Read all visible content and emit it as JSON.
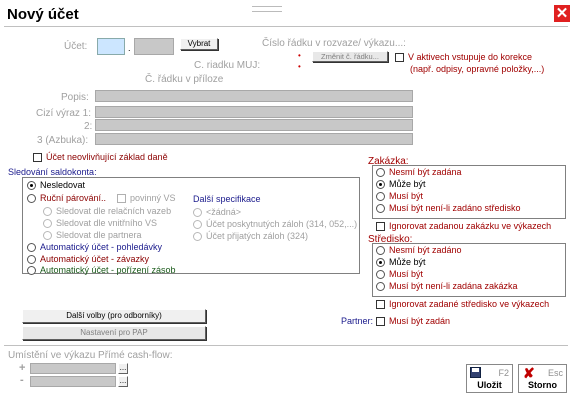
{
  "title": "Nový účet",
  "form": {
    "ucet_label": "Účet:",
    "ucet_sep": ".",
    "vybrat_label": "Vybrat",
    "cislo_radku_label": "Číslo řádku v rozvaze/ výkazu...:",
    "cislo_radku_dot": "•",
    "zmenit_label": "Změnit č. řádku...",
    "riadku_muj_label": "C. riadku MUJ:",
    "riadku_muj_dot": "•",
    "radku_priloze_label": "Č. řádku v příloze",
    "aktivech_label": "V aktivech vstupuje do korekce",
    "aktivech_sub": "(např. odpisy, opravné položky,...)",
    "popis_label": "Popis:",
    "cizi1_label": "Cizí výraz 1:",
    "cizi2_label": "2:",
    "cizi3_label": "3 (Azbuka):",
    "neovlivnujici_label": "Účet neovlivňující základ daně"
  },
  "saldo": {
    "title": "Sledování saldokonta:",
    "nesledovat": "Nesledovat",
    "rucni": "Ruční párování..",
    "povinny_vs": "povinný VS",
    "rel_vazeb": "Sledovat dle relačních vazeb",
    "vnitrniho_vs": "Sledovat dle vnitřního VS",
    "partnera": "Sledovat dle partnera",
    "dalsi_spec": "Další specifikace",
    "zadna": "<žádná>",
    "poskytnutych": "Účet poskytnutých záloh (314, 052,...)",
    "prijatych": "Účet přijatých záloh (324)",
    "auto_pohl": "Automatický účet - pohledávky",
    "auto_zav": "Automatický účet - závazky",
    "auto_zas": "Automatický účet - pořízení zásob"
  },
  "zakazka": {
    "title": "Zakázka:",
    "options": [
      "Nesmí být zadána",
      "Může být",
      "Musí být",
      "Musí být není-li zadáno středisko"
    ],
    "selected": 1,
    "ignorovat": "Ignorovat zadanou zakázku ve výkazech"
  },
  "stredisko": {
    "title": "Středisko:",
    "options": [
      "Nesmí být zadáno",
      "Může být",
      "Musí být",
      "Musí být není-li zadána zakázka"
    ],
    "selected": 1,
    "ignorovat": "Ignorovat zadané středisko ve výkazech"
  },
  "partner": {
    "label": "Partner:",
    "musi": "Musí být zadán"
  },
  "buttons": {
    "dalsi_volby": "Další volby (pro odborníky)",
    "pap": "Nastavení pro PAP",
    "ulozit": "Uložit",
    "ulozit_key": "F2",
    "storno": "Storno",
    "storno_key": "Esc"
  },
  "cashflow": {
    "label": "Umístění ve výkazu Přímé cash-flow:",
    "plus": "+",
    "minus": "-",
    "ellipsis": "..."
  },
  "colors": {
    "close": "#e02020",
    "dark_red": "#8b0000",
    "blue": "#1a1a8c",
    "green": "#1a5a1a"
  }
}
